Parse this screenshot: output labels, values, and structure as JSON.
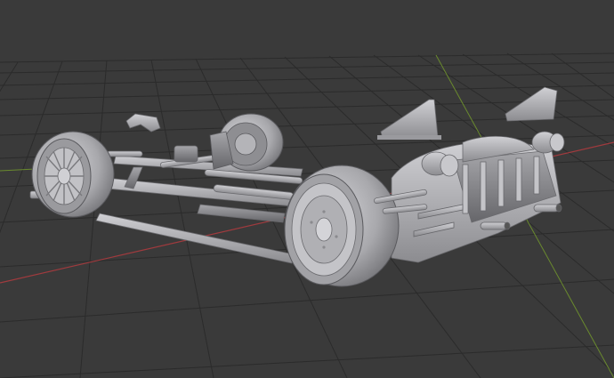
{
  "viewport": {
    "background": "#3a3a3a",
    "grid_color": "#2a2a2a",
    "x_axis_color": "#a03a3e",
    "y_axis_color": "#6a8a2e",
    "model_color": "#b8b8bc"
  },
  "scene": {
    "object": "car-chassis-model",
    "parts": [
      "rear-wheel-left",
      "front-wheel-left",
      "rear-wheel-right",
      "front-wheel-right",
      "chassis-frame",
      "engine-block",
      "exhaust-pipes",
      "wing-mount-left",
      "wing-mount-right",
      "side-mirror-bracket",
      "side-skirt-panel"
    ]
  }
}
